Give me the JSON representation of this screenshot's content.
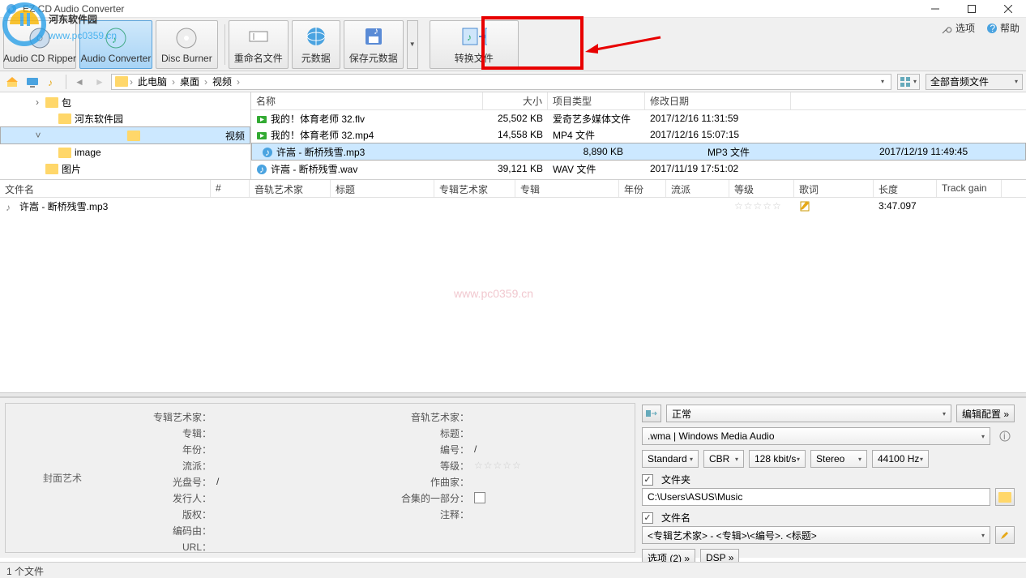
{
  "window": {
    "title": "EZ CD Audio Converter"
  },
  "watermark": {
    "site": "河东软件园",
    "url": "www.pc0359.cn",
    "center": "www.pc0359.cn"
  },
  "topright": {
    "options": "选项",
    "help": "帮助"
  },
  "toolbar": {
    "ripper": "Audio CD Ripper",
    "converter": "Audio Converter",
    "burner": "Disc Burner",
    "rename": "重命名文件",
    "metadata": "元数据",
    "savemeta": "保存元数据",
    "convert": "转换文件"
  },
  "breadcrumb": {
    "segs": [
      "此电脑",
      "桌面",
      "视频"
    ],
    "filter": "全部音频文件"
  },
  "tree": [
    {
      "label": "包",
      "indent": 40,
      "exp": ">"
    },
    {
      "label": "河东软件园",
      "indent": 56,
      "exp": ""
    },
    {
      "label": "视频",
      "indent": 40,
      "exp": "v",
      "sel": true
    },
    {
      "label": "image",
      "indent": 56,
      "exp": ""
    },
    {
      "label": "图片",
      "indent": 40,
      "exp": ""
    }
  ],
  "filecols": {
    "name": "名称",
    "size": "大小",
    "type": "项目类型",
    "date": "修改日期"
  },
  "files": [
    {
      "name": "我的！体育老师 32.flv",
      "size": "25,502 KB",
      "type": "爱奇艺多媒体文件",
      "date": "2017/12/16 11:31:59",
      "ic": "vid"
    },
    {
      "name": "我的！体育老师 32.mp4",
      "size": "14,558 KB",
      "type": "MP4 文件",
      "date": "2017/12/16 15:07:15",
      "ic": "vid"
    },
    {
      "name": "许嵩 - 断桥残雪.mp3",
      "size": "8,890 KB",
      "type": "MP3 文件",
      "date": "2017/12/19 11:49:45",
      "sel": true,
      "ic": "aud"
    },
    {
      "name": "许嵩 - 断桥残雪.wav",
      "size": "39,121 KB",
      "type": "WAV 文件",
      "date": "2017/11/19 17:51:02",
      "ic": "aud"
    }
  ],
  "qcols": {
    "file": "文件名",
    "num": "#",
    "ta": "音轨艺术家",
    "ti": "标题",
    "aa": "专辑艺术家",
    "al": "专辑",
    "yr": "年份",
    "gn": "流派",
    "rt": "等级",
    "ly": "歌词",
    "len": "长度",
    "tg": "Track gain"
  },
  "queue": [
    {
      "file": "许嵩 - 断桥残雪.mp3",
      "len": "3:47.097"
    }
  ],
  "metaLabels": {
    "cover": "封面艺术",
    "albumArtist": "专辑艺术家：",
    "album": "专辑：",
    "year": "年份：",
    "genre": "流派：",
    "discno": "光盘号：",
    "publisher": "发行人：",
    "copyright": "版权：",
    "encodedby": "编码由：",
    "url": "URL：",
    "trackArtist": "音轨艺术家：",
    "title": "标题：",
    "trackno": "编号：",
    "rating": "等级：",
    "composer": "作曲家：",
    "partofset": "合集的一部分：",
    "comment": "注释："
  },
  "metaValues": {
    "discno": "/",
    "trackno": "/"
  },
  "settings": {
    "preset": "正常",
    "editPreset": "编辑配置 »",
    "format": ".wma | Windows Media Audio",
    "q1": "Standard",
    "q2": "CBR",
    "q3": "128 kbit/s",
    "q4": "Stereo",
    "q5": "44100 Hz",
    "folderChk": "文件夹",
    "folderPath": "C:\\Users\\ASUS\\Music",
    "fileChk": "文件名",
    "filePattern": "<专辑艺术家> - <专辑>\\<编号>. <标题>",
    "optBtn": "选项 (2) »",
    "dspBtn": "DSP »"
  },
  "status": "1 个文件"
}
